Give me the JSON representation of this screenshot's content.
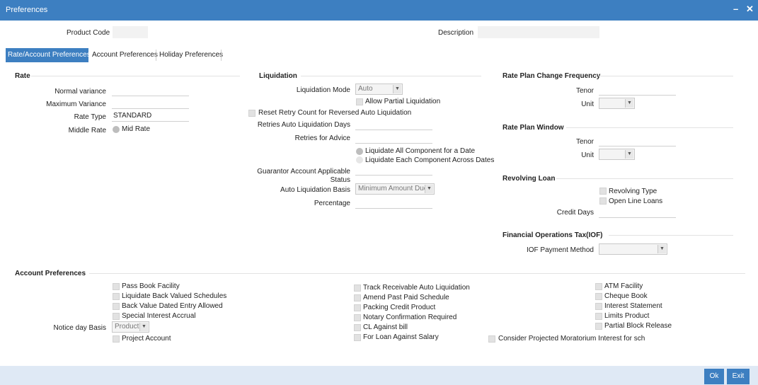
{
  "window": {
    "title": "Preferences",
    "minimize": "–",
    "close": "✕"
  },
  "header": {
    "product_code_label": "Product Code",
    "product_code_value": "",
    "description_label": "Description",
    "description_value": ""
  },
  "tabs": [
    {
      "label": "Rate/Account Preferences",
      "active": true
    },
    {
      "label": "Account Preferences",
      "active": false
    },
    {
      "label": "Holiday Preferences",
      "active": false
    }
  ],
  "rate": {
    "title": "Rate",
    "normal_variance_label": "Normal variance",
    "normal_variance": "",
    "maximum_variance_label": "Maximum Variance",
    "maximum_variance": "",
    "rate_type_label": "Rate Type",
    "rate_type": "STANDARD",
    "middle_rate_label": "Middle Rate",
    "mid_rate_option": "Mid Rate"
  },
  "liquidation": {
    "title": "Liquidation",
    "mode_label": "Liquidation Mode",
    "mode_value": "Auto",
    "allow_partial": "Allow Partial Liquidation",
    "reset_retry": "Reset Retry Count for Reversed Auto Liquidation",
    "retries_auto_label": "Retries Auto Liquidation Days",
    "retries_auto": "",
    "retries_advice_label": "Retries for Advice",
    "retries_advice": "",
    "liq_all_component": "Liquidate All Component for a Date",
    "liq_each_component": "Liquidate Each Component Across Dates",
    "guarantor_label_1": "Guarantor Account Applicable",
    "guarantor_label_2": "Status",
    "auto_basis_label": "Auto Liquidation Basis",
    "auto_basis_value": "Minimum Amount Due",
    "percentage_label": "Percentage",
    "percentage": ""
  },
  "rate_plan_change": {
    "title": "Rate Plan Change Frequency",
    "tenor_label": "Tenor",
    "unit_label": "Unit"
  },
  "rate_plan_window": {
    "title": "Rate Plan Window",
    "tenor_label": "Tenor",
    "unit_label": "Unit"
  },
  "revolving_loan": {
    "title": "Revolving Loan",
    "revolving_type": "Revolving Type",
    "open_line_loans": "Open Line Loans",
    "credit_days_label": "Credit Days"
  },
  "iof": {
    "title": "Financial Operations Tax(IOF)",
    "payment_method_label": "IOF Payment Method"
  },
  "account_prefs": {
    "title": "Account Preferences",
    "col1": [
      "Pass Book Facility",
      "Liquidate Back Valued Schedules",
      "Back Value Dated Entry Allowed",
      "Special Interest Accrual"
    ],
    "notice_day_basis_label": "Notice day Basis",
    "notice_day_basis_value": "Product",
    "project_account": "Project Account",
    "col2": [
      "Track Receivable Auto Liquidation",
      "Amend Past Paid Schedule",
      "Packing Credit Product",
      "Notary Confirmation Required",
      "CL Against bill",
      "For Loan Against Salary"
    ],
    "col3": [
      "ATM Facility",
      "Cheque Book",
      "Interest Statement",
      "Limits Product",
      "Partial Block Release"
    ],
    "projected_moratorium": "Consider Projected Moratorium Interest for sch"
  },
  "footer": {
    "ok": "Ok",
    "exit": "Exit"
  },
  "colors": {
    "accent": "#3d7fc1",
    "footer_bg": "#dfe9f5"
  }
}
